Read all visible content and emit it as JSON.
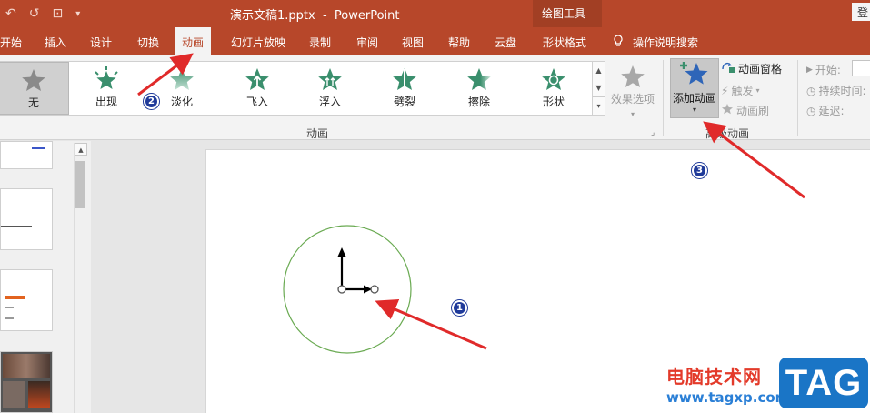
{
  "colors": {
    "accent": "#b7472a",
    "accent_dark": "#a23f24",
    "ribbon_bg": "#f3f3f3",
    "badge": "#1f3a9a",
    "arrow": "#e02a2a",
    "star_green": "#3a8f6d",
    "star_blue": "#2e65b8",
    "circle": "#6aaa52"
  },
  "titlebar": {
    "title": "演示文稿1.pptx  -  PowerPoint",
    "context_group": "绘图工具",
    "login": "登"
  },
  "tabs": [
    {
      "label": "开始",
      "active": false
    },
    {
      "label": "插入",
      "active": false
    },
    {
      "label": "设计",
      "active": false
    },
    {
      "label": "切换",
      "active": false
    },
    {
      "label": "动画",
      "active": true
    },
    {
      "label": "幻灯片放映",
      "active": false
    },
    {
      "label": "录制",
      "active": false
    },
    {
      "label": "审阅",
      "active": false
    },
    {
      "label": "视图",
      "active": false
    },
    {
      "label": "帮助",
      "active": false
    },
    {
      "label": "云盘",
      "active": false
    },
    {
      "label": "形状格式",
      "active": false
    }
  ],
  "tell_me": "操作说明搜索",
  "gallery": {
    "items": [
      {
        "label": "无",
        "icon": "star-none-icon",
        "selected": true
      },
      {
        "label": "出现",
        "icon": "star-appear-icon",
        "selected": false
      },
      {
        "label": "淡化",
        "icon": "star-fade-icon",
        "selected": false
      },
      {
        "label": "飞入",
        "icon": "star-flyin-icon",
        "selected": false
      },
      {
        "label": "浮入",
        "icon": "star-floatin-icon",
        "selected": false
      },
      {
        "label": "劈裂",
        "icon": "star-split-icon",
        "selected": false
      },
      {
        "label": "擦除",
        "icon": "star-wipe-icon",
        "selected": false
      },
      {
        "label": "形状",
        "icon": "star-shape-icon",
        "selected": false
      }
    ],
    "effect_options": "效果选项",
    "group_label": "动画"
  },
  "advanced": {
    "add_animation": "添加动画",
    "animation_pane": "动画窗格",
    "trigger": "触发",
    "animation_painter": "动画刷",
    "group_label": "高级动画"
  },
  "timing": {
    "start": "开始:",
    "duration": "持续时间:",
    "delay": "延迟:"
  },
  "badges": [
    "1",
    "2",
    "3"
  ],
  "watermark": {
    "brand": "电脑技术网",
    "url": "www.tagxp.com",
    "tag": "TAG"
  }
}
